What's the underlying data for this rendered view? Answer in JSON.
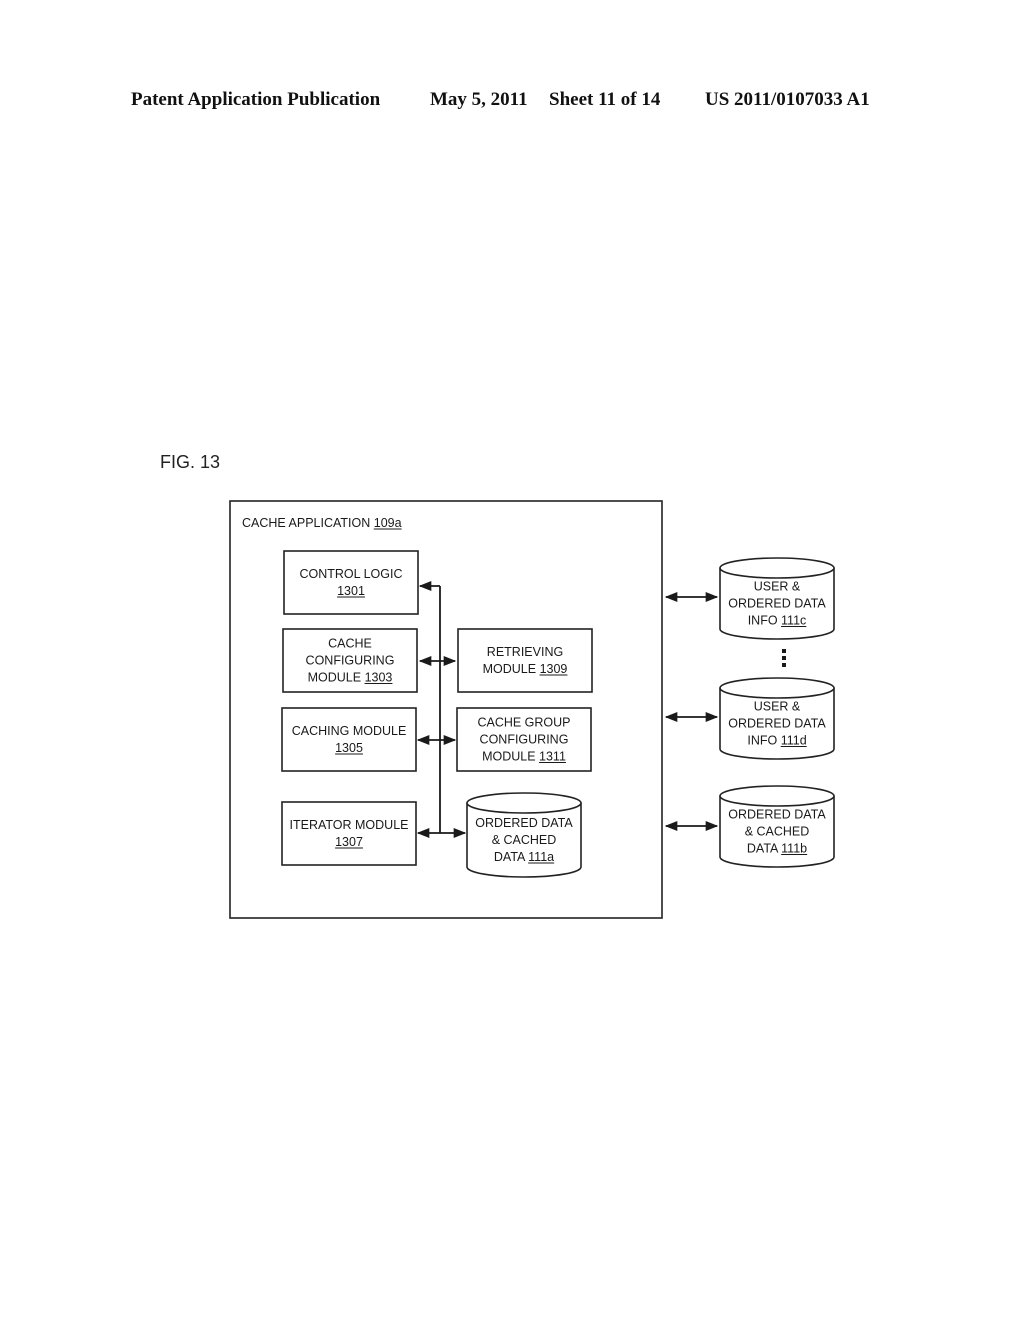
{
  "header": {
    "publication": "Patent Application Publication",
    "date": "May 5, 2011",
    "sheet": "Sheet 11 of 14",
    "number": "US 2011/0107033 A1"
  },
  "figure": {
    "label": "FIG. 13",
    "container": {
      "title": "CACHE APPLICATION",
      "ref": "109a"
    },
    "modules": [
      {
        "id": "control-logic",
        "lines": [
          "CONTROL LOGIC"
        ],
        "ref": "1301",
        "ref_inline": false
      },
      {
        "id": "cache-configuring",
        "lines": [
          "CACHE",
          "CONFIGURING",
          "MODULE"
        ],
        "ref": "1303",
        "ref_inline": true
      },
      {
        "id": "caching",
        "lines": [
          "CACHING MODULE"
        ],
        "ref": "1305",
        "ref_inline": false
      },
      {
        "id": "iterator",
        "lines": [
          "ITERATOR MODULE"
        ],
        "ref": "1307",
        "ref_inline": false
      },
      {
        "id": "retrieving",
        "lines": [
          "RETRIEVING",
          "MODULE"
        ],
        "ref": "1309",
        "ref_inline": true
      },
      {
        "id": "cache-group-configuring",
        "lines": [
          "CACHE GROUP",
          "CONFIGURING",
          "MODULE"
        ],
        "ref": "1311",
        "ref_inline": true
      }
    ],
    "databases": [
      {
        "id": "ordered-cached-111a",
        "lines": [
          "ORDERED DATA",
          "& CACHED",
          "DATA"
        ],
        "ref": "111a"
      },
      {
        "id": "user-ordered-111c",
        "lines": [
          "USER &",
          "ORDERED DATA",
          "INFO"
        ],
        "ref": "111c"
      },
      {
        "id": "user-ordered-111d",
        "lines": [
          "USER &",
          "ORDERED DATA",
          "INFO"
        ],
        "ref": "111d"
      },
      {
        "id": "ordered-cached-111b",
        "lines": [
          "ORDERED DATA",
          "& CACHED",
          "DATA"
        ],
        "ref": "111b"
      }
    ],
    "ellipsis": "⋮"
  }
}
